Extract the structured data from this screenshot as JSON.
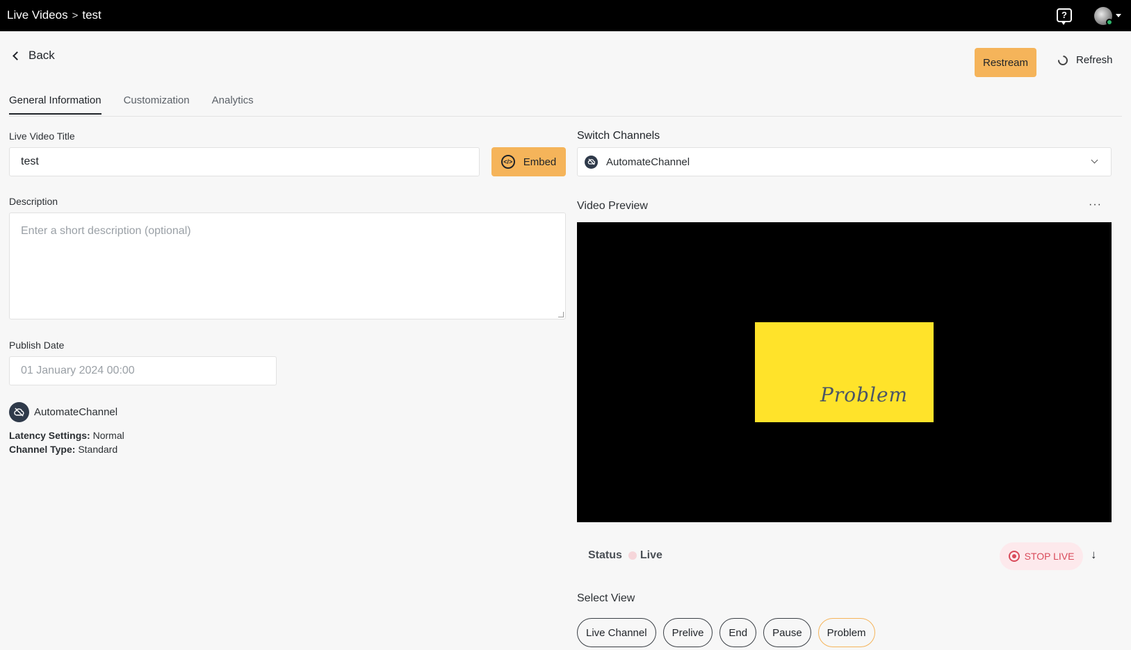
{
  "breadcrumb": {
    "parent": "Live Videos",
    "separator": ">",
    "current": "test"
  },
  "topbar": {
    "help_icon": "help-chat-icon",
    "avatar_icon": "user-avatar"
  },
  "header": {
    "back_label": "Back",
    "restream_label": "Restream",
    "refresh_label": "Refresh"
  },
  "tabs": [
    {
      "label": "General Information",
      "active": true
    },
    {
      "label": "Customization",
      "active": false
    },
    {
      "label": "Analytics",
      "active": false
    }
  ],
  "form": {
    "title_label": "Live Video Title",
    "title_value": "test",
    "embed_label": "Embed",
    "description_label": "Description",
    "description_placeholder": "Enter a short description (optional)",
    "publish_label": "Publish Date",
    "publish_placeholder": "01 January 2024 00:00"
  },
  "channel_info": {
    "name": "AutomateChannel",
    "latency_key": "Latency Settings:",
    "latency_value": "Normal",
    "type_key": "Channel Type:",
    "type_value": "Standard"
  },
  "switch": {
    "label": "Switch Channels",
    "selected": "AutomateChannel"
  },
  "preview": {
    "label": "Video Preview",
    "more": "···",
    "slide_text": "Problem",
    "slide_color": "#ffe32a"
  },
  "status": {
    "label": "Status",
    "value": "Live",
    "stop_label": "STOP LIVE",
    "down_arrow": "↓"
  },
  "select_view": {
    "label": "Select View",
    "options": [
      "Live Channel",
      "Prelive",
      "End",
      "Pause",
      "Problem"
    ],
    "active": "Problem"
  },
  "colors": {
    "accent": "#f5b45a",
    "danger": "#d94a5a",
    "topbar": "#000000"
  }
}
